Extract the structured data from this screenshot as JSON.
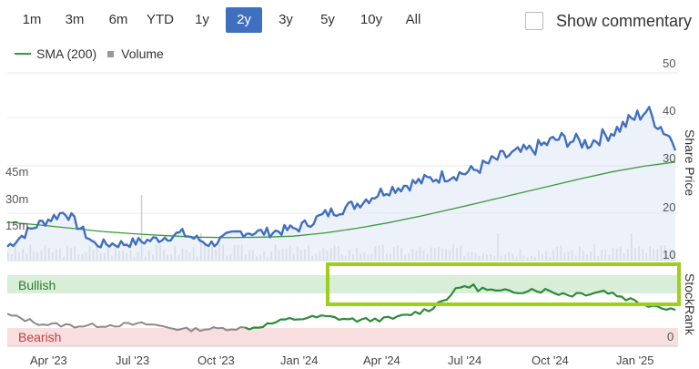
{
  "toolbar": {
    "ranges": [
      "1m",
      "3m",
      "6m",
      "YTD",
      "1y",
      "2y",
      "3y",
      "5y",
      "10y",
      "All"
    ],
    "active": "2y",
    "show_commentary_label": "Show commentary",
    "show_commentary_checked": false
  },
  "legend": {
    "sma_label": "SMA (200)",
    "volume_label": "Volume"
  },
  "axes": {
    "price_label": "Share Price",
    "stockrank_label": "StockRank",
    "price_ticks": [
      "50",
      "40",
      "30",
      "20",
      "10"
    ],
    "stockrank_tick": "0",
    "volume_ticks": [
      "45m",
      "30m",
      "15m"
    ],
    "x_ticks": [
      "Apr '23",
      "Jul '23",
      "Oct '23",
      "Jan '24",
      "Apr '24",
      "Jul '24",
      "Oct '24",
      "Jan '25"
    ]
  },
  "bands": {
    "bullish_label": "Bullish",
    "bearish_label": "Bearish"
  },
  "colors": {
    "active_button": "#3f6fbf",
    "price_line": "#3f6fbf",
    "sma_line": "#3a9a3a",
    "bullish_band": "#d8eed8",
    "bearish_band": "#f8dede",
    "highlight_box": "#9ccf1e"
  },
  "chart_data": {
    "type": "line",
    "ylim": [
      10,
      50
    ],
    "series": [
      {
        "name": "SMA (200)",
        "kind": "line",
        "values": [
          18.2,
          17.6,
          16.9,
          16.2,
          15.7,
          15.3,
          15.0,
          14.9,
          15.0,
          15.2,
          15.9,
          16.9,
          18.1,
          19.5,
          21.0,
          22.6,
          24.2,
          25.8,
          27.4,
          28.9,
          30.1,
          31.0
        ]
      },
      {
        "name": "Share Price",
        "values": [
          13.0,
          17.5,
          20.5,
          13.5,
          13.6,
          14.4,
          15.8,
          13.5,
          16.1,
          16.0,
          16.9,
          20.0,
          22.0,
          25.0,
          26.5,
          28.0,
          29.0,
          32.0,
          33.5,
          36.0,
          35.0,
          38.0,
          42.0,
          35.0
        ]
      },
      {
        "name": "StockRank",
        "values": [
          17.0,
          12.0,
          11.0,
          11.5,
          12.0,
          9.0,
          9.5,
          10.0,
          14.5,
          16.0,
          14.0,
          15.0,
          20.0,
          33.0,
          29.0,
          31.0,
          28.0,
          30.0,
          23.5,
          20.0
        ]
      }
    ]
  }
}
